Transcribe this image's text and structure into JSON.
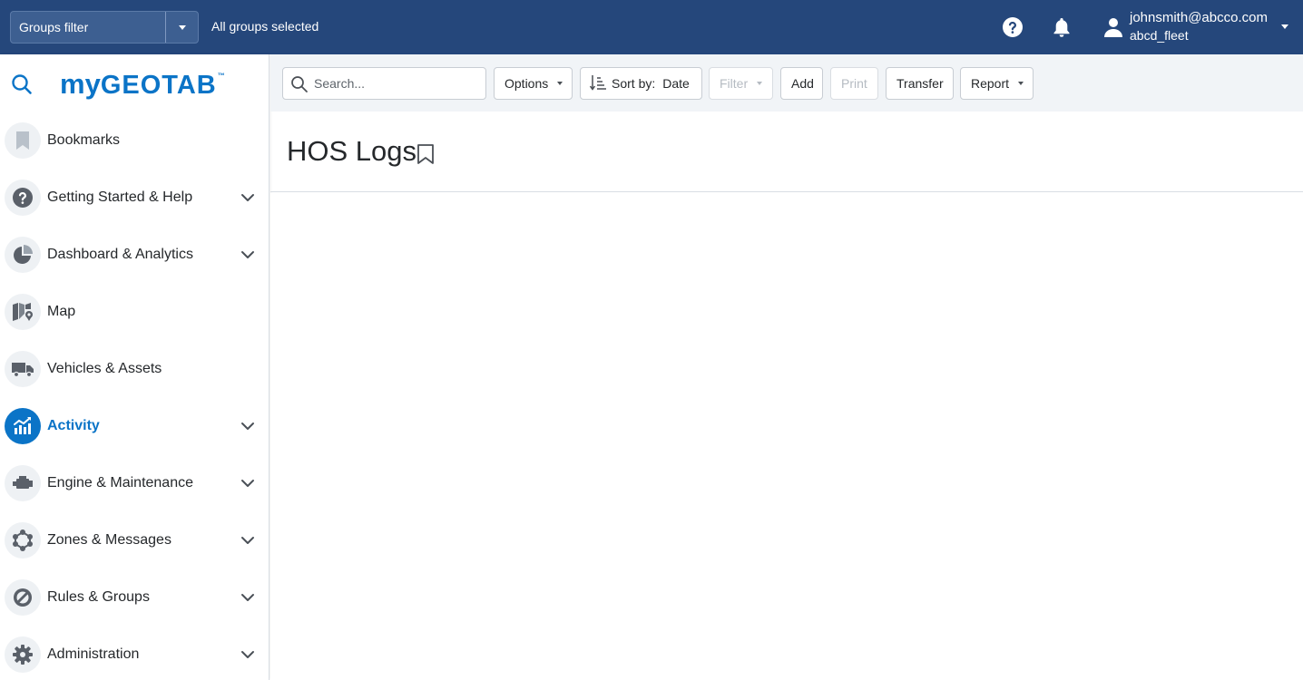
{
  "topbar": {
    "groups_filter_label": "Groups filter",
    "groups_selected": "All groups selected",
    "user_email": "johnsmith@abcco.com",
    "user_database": "abcd_fleet",
    "icons": [
      "help-icon",
      "bell-icon",
      "user-icon"
    ]
  },
  "sidebar": {
    "logo": {
      "my": "my",
      "brand": "GEOTAB",
      "tm": "™"
    },
    "items": [
      {
        "label": "Bookmarks",
        "icon": "bookmark-icon",
        "expandable": false,
        "active": false
      },
      {
        "label": "Getting Started & Help",
        "icon": "help-circle-icon",
        "expandable": true,
        "active": false
      },
      {
        "label": "Dashboard & Analytics",
        "icon": "pie-chart-icon",
        "expandable": true,
        "active": false
      },
      {
        "label": "Map",
        "icon": "map-icon",
        "expandable": false,
        "active": false
      },
      {
        "label": "Vehicles & Assets",
        "icon": "truck-icon",
        "expandable": false,
        "active": false
      },
      {
        "label": "Activity",
        "icon": "activity-chart-icon",
        "expandable": true,
        "active": true
      },
      {
        "label": "Engine & Maintenance",
        "icon": "engine-icon",
        "expandable": true,
        "active": false
      },
      {
        "label": "Zones & Messages",
        "icon": "zones-icon",
        "expandable": true,
        "active": false
      },
      {
        "label": "Rules & Groups",
        "icon": "rules-icon",
        "expandable": true,
        "active": false
      },
      {
        "label": "Administration",
        "icon": "gear-icon",
        "expandable": true,
        "active": false
      }
    ]
  },
  "toolbar": {
    "search_placeholder": "Search...",
    "options_label": "Options",
    "sort_label": "Sort by:",
    "sort_value": "Date",
    "filter_label": "Filter",
    "add_label": "Add",
    "print_label": "Print",
    "transfer_label": "Transfer",
    "report_label": "Report"
  },
  "page": {
    "title": "HOS Logs"
  },
  "colors": {
    "topbar": "#25477b",
    "accent": "#0b74c7",
    "toolbar_bg": "#f1f4f7"
  }
}
